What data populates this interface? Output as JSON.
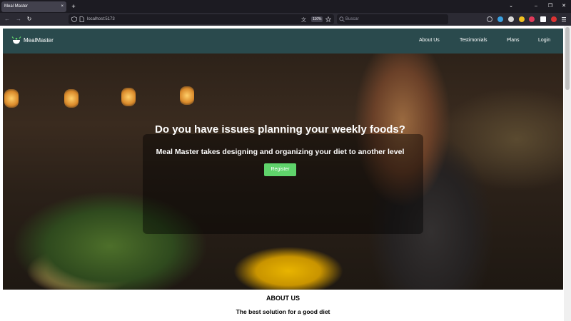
{
  "browser": {
    "tab_title": "Meal Master",
    "tab_close": "×",
    "new_tab": "+",
    "url": "localhost:5173",
    "zoom": "110%",
    "search_placeholder": "Buscar",
    "window_controls": {
      "list": "⌄",
      "minimize": "–",
      "restore": "❐",
      "close": "✕"
    },
    "nav_icons": {
      "back": "←",
      "forward": "→",
      "reload": "↻"
    }
  },
  "site": {
    "brand": "MealMaster",
    "nav": [
      {
        "label": "About Us"
      },
      {
        "label": "Testimonials"
      },
      {
        "label": "Plans"
      },
      {
        "label": "Login"
      }
    ],
    "hero": {
      "title": "Do you have issues planning your weekly foods?",
      "subtitle": "Meal Master takes designing and organizing your diet to another level",
      "cta": "Register"
    },
    "about": {
      "heading": "ABOUT US",
      "tagline": "The best solution for a good diet"
    }
  },
  "colors": {
    "nav_bg": "#2a4a4d",
    "cta_bg": "#5fd36b",
    "browser_bg": "#1c1b22",
    "toolbar_bg": "#2b2a33"
  },
  "icons": [
    "page-icon",
    "translate-icon",
    "star-icon",
    "search-icon",
    "shield-icon",
    "download-icon",
    "extension-icon",
    "menu-icon",
    "logo-bowl-icon"
  ]
}
